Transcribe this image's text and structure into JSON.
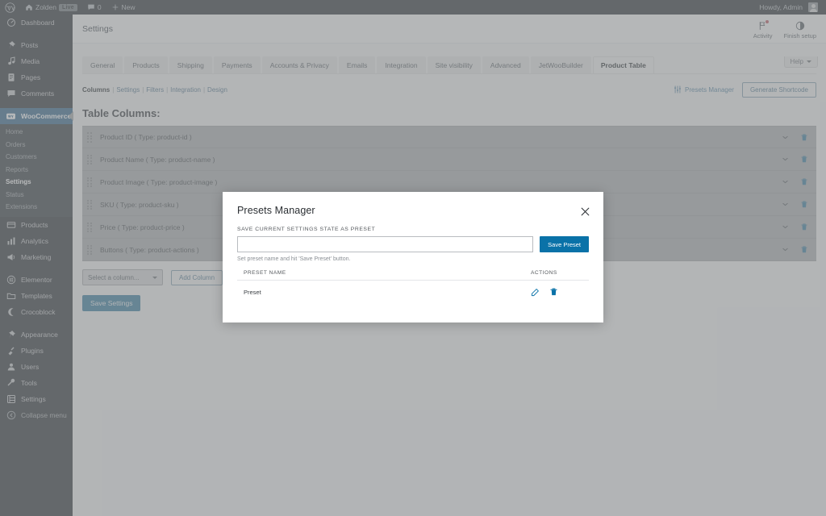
{
  "adminbar": {
    "logo_icon": "wordpress-logo-icon",
    "site_icon": "home-icon",
    "site_name": "Zolden",
    "live_badge": "Live",
    "comments_icon": "comment-icon",
    "comments_count": "0",
    "new_icon": "plus-icon",
    "new_label": "New",
    "howdy": "Howdy, Admin",
    "avatar_icon": "avatar"
  },
  "sidebar": {
    "items": [
      {
        "label": "Dashboard",
        "icon": "dashboard-icon",
        "state": "normal"
      },
      {
        "label": "Posts",
        "icon": "pin-icon",
        "state": "normal"
      },
      {
        "label": "Media",
        "icon": "media-icon",
        "state": "normal"
      },
      {
        "label": "Pages",
        "icon": "page-icon",
        "state": "normal"
      },
      {
        "label": "Comments",
        "icon": "comment-icon",
        "state": "normal"
      },
      {
        "label": "WooCommerce",
        "icon": "woocommerce-icon",
        "state": "active"
      },
      {
        "label": "Products",
        "icon": "products-icon",
        "state": "normal"
      },
      {
        "label": "Analytics",
        "icon": "analytics-icon",
        "state": "normal"
      },
      {
        "label": "Marketing",
        "icon": "megaphone-icon",
        "state": "normal"
      },
      {
        "label": "Elementor",
        "icon": "elementor-icon",
        "state": "normal"
      },
      {
        "label": "Templates",
        "icon": "templates-icon",
        "state": "normal"
      },
      {
        "label": "Crocoblock",
        "icon": "crocoblock-icon",
        "state": "normal"
      },
      {
        "label": "Appearance",
        "icon": "brush-icon",
        "state": "normal"
      },
      {
        "label": "Plugins",
        "icon": "plugin-icon",
        "state": "normal"
      },
      {
        "label": "Users",
        "icon": "users-icon",
        "state": "normal"
      },
      {
        "label": "Tools",
        "icon": "tools-icon",
        "state": "normal"
      },
      {
        "label": "Settings",
        "icon": "settings-icon",
        "state": "normal"
      },
      {
        "label": "Collapse menu",
        "icon": "collapse-icon",
        "state": "dim"
      }
    ],
    "woocommerce_submenu": [
      {
        "label": "Home",
        "current": false
      },
      {
        "label": "Orders",
        "current": false
      },
      {
        "label": "Customers",
        "current": false
      },
      {
        "label": "Reports",
        "current": false
      },
      {
        "label": "Settings",
        "current": true
      },
      {
        "label": "Status",
        "current": false
      },
      {
        "label": "Extensions",
        "current": false
      }
    ]
  },
  "header": {
    "page_title": "Settings",
    "activity_label": "Activity",
    "activity_icon": "flag-icon",
    "finish_setup_label": "Finish setup",
    "finish_setup_icon": "half-circle-icon",
    "help_label": "Help",
    "help_icon": "chevron-down-icon"
  },
  "tabs": [
    {
      "label": "General",
      "active": false
    },
    {
      "label": "Products",
      "active": false
    },
    {
      "label": "Shipping",
      "active": false
    },
    {
      "label": "Payments",
      "active": false
    },
    {
      "label": "Accounts & Privacy",
      "active": false
    },
    {
      "label": "Emails",
      "active": false
    },
    {
      "label": "Integration",
      "active": false
    },
    {
      "label": "Site visibility",
      "active": false
    },
    {
      "label": "Advanced",
      "active": false
    },
    {
      "label": "JetWooBuilder",
      "active": false
    },
    {
      "label": "Product Table",
      "active": true
    }
  ],
  "subnav": {
    "items": [
      {
        "label": "Columns",
        "current": true
      },
      {
        "label": "Settings",
        "current": false
      },
      {
        "label": "Filters",
        "current": false
      },
      {
        "label": "Integration",
        "current": false
      },
      {
        "label": "Design",
        "current": false
      }
    ],
    "separator": "|",
    "presets_manager_label": "Presets Manager",
    "presets_manager_icon": "sliders-icon",
    "generate_shortcode_label": "Generate Shortcode"
  },
  "main": {
    "section_title": "Table Columns:",
    "columns": [
      {
        "label": "Product ID ( Type: product-id )"
      },
      {
        "label": "Product Name ( Type: product-name )"
      },
      {
        "label": "Product Image ( Type: product-image )"
      },
      {
        "label": "SKU ( Type: product-sku )"
      },
      {
        "label": "Price ( Type: product-price )"
      },
      {
        "label": "Buttons ( Type: product-actions )"
      }
    ],
    "row_expand_icon": "chevron-down-icon",
    "row_delete_icon": "trash-icon",
    "drag_handle_icon": "drag-handle-icon",
    "select_column_value": "Select a column...",
    "add_column_label": "Add Column",
    "save_settings_label": "Save Settings"
  },
  "modal": {
    "title": "Presets Manager",
    "close_icon": "close-icon",
    "field_label": "SAVE CURRENT SETTINGS STATE AS PRESET",
    "input_value": "",
    "input_placeholder": "",
    "save_preset_label": "Save Preset",
    "hint": "Set preset name and hit 'Save Preset' button.",
    "table": {
      "headers": {
        "name": "PRESET NAME",
        "actions": "ACTIONS"
      },
      "rows": [
        {
          "name": "Preset",
          "edit_icon": "pencil-icon",
          "delete_icon": "trash-icon"
        }
      ]
    }
  },
  "colors": {
    "admin_bar": "#23282d",
    "sidebar": "#23282d",
    "submenu": "#2c3338",
    "active_menu": "#2a5f87",
    "accent_blue": "#0a72a8",
    "link_blue": "#4a7d9e",
    "row_bg": "#a9abae",
    "overlay": "#8c8f92"
  }
}
